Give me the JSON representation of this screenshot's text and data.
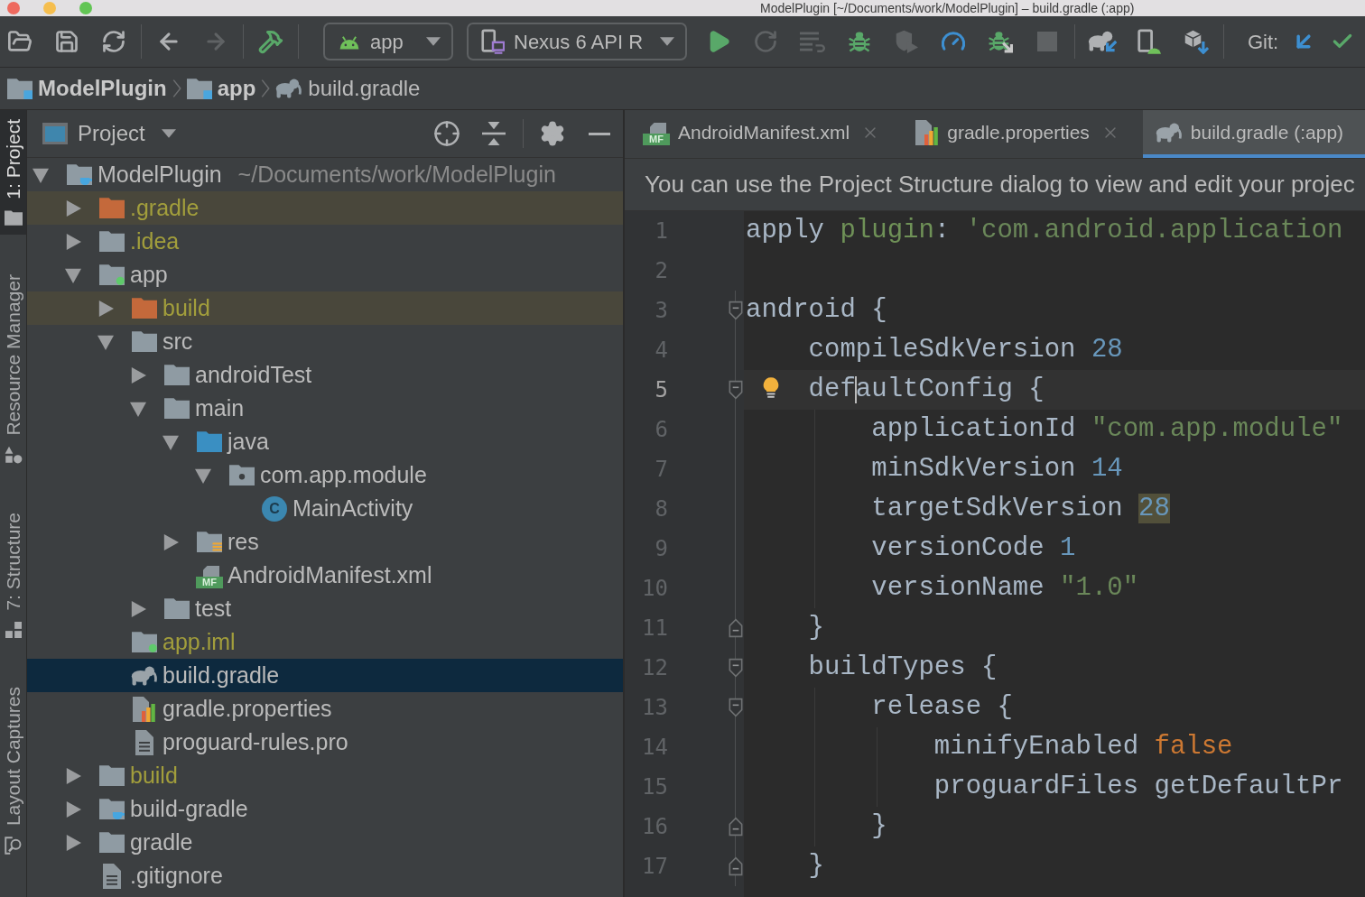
{
  "window": {
    "title": "ModelPlugin [~/Documents/work/ModelPlugin] – build.gradle (:app)"
  },
  "toolbar": [
    {
      "kind": "open",
      "disabled": false
    },
    {
      "kind": "save",
      "disabled": false
    },
    {
      "kind": "sync",
      "disabled": false
    },
    {
      "kind": "separator"
    },
    {
      "kind": "back",
      "disabled": false
    },
    {
      "kind": "forward",
      "disabled": true
    },
    {
      "kind": "separator"
    },
    {
      "kind": "build",
      "disabled": false
    },
    {
      "kind": "separator"
    },
    {
      "kind": "config",
      "label": "app"
    },
    {
      "kind": "device",
      "label": "Nexus 6 API R"
    },
    {
      "kind": "run",
      "disabled": false
    },
    {
      "kind": "apply",
      "disabled": true
    },
    {
      "kind": "hotswap",
      "disabled": true
    },
    {
      "kind": "debug",
      "disabled": false
    },
    {
      "kind": "coverage",
      "disabled": true
    },
    {
      "kind": "profile",
      "disabled": false
    },
    {
      "kind": "attach",
      "disabled": false
    },
    {
      "kind": "stop",
      "disabled": true
    },
    {
      "kind": "separator"
    },
    {
      "kind": "gradlesync",
      "disabled": false
    },
    {
      "kind": "avd",
      "disabled": false
    },
    {
      "kind": "sdk",
      "disabled": false
    },
    {
      "kind": "separator"
    },
    {
      "kind": "label",
      "label": "Git:"
    },
    {
      "kind": "update",
      "disabled": false
    },
    {
      "kind": "commit",
      "disabled": false
    }
  ],
  "breadcrumbs": [
    {
      "kind": "module",
      "label": "ModelPlugin"
    },
    {
      "kind": "module",
      "label": "app"
    },
    {
      "kind": "gradle",
      "label": "build.gradle"
    }
  ],
  "tool_tabs": [
    {
      "kind": "project",
      "label": "1: Project",
      "selected": true
    },
    {
      "kind": "resources",
      "label": "Resource Manager",
      "selected": false
    },
    {
      "kind": "structure",
      "label": "7: Structure",
      "selected": false
    },
    {
      "kind": "captures",
      "label": "Layout Captures",
      "selected": false
    }
  ],
  "project_panel": {
    "title": "Project",
    "tree": [
      {
        "name": "ModelPlugin",
        "path": "~/Documents/work/ModelPlugin",
        "kind": "project",
        "expanded": true,
        "ignored": false,
        "tinted": false,
        "selected": false,
        "children": [
          {
            "name": ".gradle",
            "kind": "excluded",
            "expanded": false,
            "ignored": true,
            "tinted": true,
            "selected": false
          },
          {
            "name": ".idea",
            "kind": "folder",
            "expanded": false,
            "ignored": true,
            "tinted": false,
            "selected": false
          },
          {
            "name": "app",
            "kind": "module",
            "expanded": true,
            "ignored": false,
            "tinted": false,
            "selected": false,
            "children": [
              {
                "name": "build",
                "kind": "excluded",
                "expanded": false,
                "ignored": true,
                "tinted": true,
                "selected": false
              },
              {
                "name": "src",
                "kind": "folder",
                "expanded": true,
                "ignored": false,
                "tinted": false,
                "selected": false,
                "children": [
                  {
                    "name": "androidTest",
                    "kind": "folder",
                    "expanded": false,
                    "ignored": false,
                    "tinted": false,
                    "selected": false
                  },
                  {
                    "name": "main",
                    "kind": "folder",
                    "expanded": true,
                    "ignored": false,
                    "tinted": false,
                    "selected": false,
                    "children": [
                      {
                        "name": "java",
                        "kind": "source",
                        "expanded": true,
                        "ignored": false,
                        "tinted": false,
                        "selected": false,
                        "children": [
                          {
                            "name": "com.app.module",
                            "kind": "package",
                            "expanded": true,
                            "ignored": false,
                            "tinted": false,
                            "selected": false,
                            "children": [
                              {
                                "name": "MainActivity",
                                "kind": "class",
                                "badge": "C",
                                "ignored": false,
                                "tinted": false,
                                "selected": false
                              }
                            ]
                          }
                        ]
                      },
                      {
                        "name": "res",
                        "kind": "resources",
                        "expanded": false,
                        "ignored": false,
                        "tinted": false,
                        "selected": false
                      },
                      {
                        "name": "AndroidManifest.xml",
                        "kind": "manifest",
                        "badge": "MF",
                        "ignored": false,
                        "tinted": false,
                        "selected": false
                      }
                    ]
                  },
                  {
                    "name": "test",
                    "kind": "folder",
                    "expanded": false,
                    "ignored": false,
                    "tinted": false,
                    "selected": false
                  }
                ]
              },
              {
                "name": "app.iml",
                "kind": "iml",
                "ignored": true,
                "tinted": false,
                "selected": false
              },
              {
                "name": "build.gradle",
                "kind": "gradle",
                "ignored": false,
                "tinted": false,
                "selected": true
              },
              {
                "name": "gradle.properties",
                "kind": "properties",
                "ignored": false,
                "tinted": false,
                "selected": false
              },
              {
                "name": "proguard-rules.pro",
                "kind": "text",
                "ignored": false,
                "tinted": false,
                "selected": false
              }
            ]
          },
          {
            "name": "build",
            "kind": "folder",
            "expanded": false,
            "ignored": true,
            "tinted": false,
            "selected": false
          },
          {
            "name": "build-gradle",
            "kind": "project",
            "expanded": false,
            "ignored": false,
            "tinted": false,
            "selected": false
          },
          {
            "name": "gradle",
            "kind": "folder",
            "expanded": false,
            "ignored": false,
            "tinted": false,
            "selected": false
          },
          {
            "name": ".gitignore",
            "kind": "text",
            "ignored": false,
            "tinted": false,
            "selected": false
          }
        ]
      }
    ]
  },
  "editor": {
    "tabs": [
      {
        "kind": "manifest",
        "badge": "MF",
        "label": "AndroidManifest.xml",
        "selected": false
      },
      {
        "kind": "properties",
        "label": "gradle.properties",
        "selected": false
      },
      {
        "kind": "gradle",
        "label": "build.gradle (:app)",
        "selected": true
      }
    ],
    "notification": "You can use the Project Structure dialog to view and edit your projec",
    "lines": [
      {
        "number": "1",
        "current": false,
        "tokens": [
          {
            "kind": "plain",
            "text": "apply ",
            "highlighted": false
          },
          {
            "kind": "named",
            "text": "plugin",
            "highlighted": false
          },
          {
            "kind": "plain",
            "text": ": ",
            "highlighted": false
          },
          {
            "kind": "string",
            "text": "'com.android.application",
            "highlighted": false
          }
        ]
      },
      {
        "number": "2",
        "current": false
      },
      {
        "number": "3",
        "current": false,
        "fold_start": true,
        "tokens": [
          {
            "kind": "plain",
            "text": "android {",
            "highlighted": false
          }
        ]
      },
      {
        "number": "4",
        "current": false,
        "tokens": [
          {
            "kind": "plain",
            "text": "    compileSdkVersion ",
            "highlighted": false
          },
          {
            "kind": "number",
            "text": "28",
            "highlighted": false
          }
        ]
      },
      {
        "number": "5",
        "current": true,
        "fold_start": true,
        "tokens": [
          {
            "kind": "plain",
            "text": "    def",
            "highlighted": false
          },
          {
            "kind": "caret"
          },
          {
            "kind": "plain",
            "text": "aultConfig {",
            "highlighted": false
          }
        ]
      },
      {
        "number": "6",
        "current": false,
        "tokens": [
          {
            "kind": "plain",
            "text": "        applicationId ",
            "highlighted": false
          },
          {
            "kind": "string",
            "text": "\"com.app.module\"",
            "highlighted": false
          }
        ]
      },
      {
        "number": "7",
        "current": false,
        "tokens": [
          {
            "kind": "plain",
            "text": "        minSdkVersion ",
            "highlighted": false
          },
          {
            "kind": "number",
            "text": "14",
            "highlighted": false
          }
        ]
      },
      {
        "number": "8",
        "current": false,
        "tokens": [
          {
            "kind": "plain",
            "text": "        targetSdkVersion ",
            "highlighted": false
          },
          {
            "kind": "number",
            "text": "28",
            "highlighted": true
          }
        ]
      },
      {
        "number": "9",
        "current": false,
        "tokens": [
          {
            "kind": "plain",
            "text": "        versionCode ",
            "highlighted": false
          },
          {
            "kind": "number",
            "text": "1",
            "highlighted": false
          }
        ]
      },
      {
        "number": "10",
        "current": false,
        "tokens": [
          {
            "kind": "plain",
            "text": "        versionName ",
            "highlighted": false
          },
          {
            "kind": "string",
            "text": "\"1.0\"",
            "highlighted": false
          }
        ]
      },
      {
        "number": "11",
        "current": false,
        "fold_end": true,
        "tokens": [
          {
            "kind": "plain",
            "text": "    }",
            "highlighted": false
          }
        ]
      },
      {
        "number": "12",
        "current": false,
        "fold_start": true,
        "tokens": [
          {
            "kind": "plain",
            "text": "    buildTypes {",
            "highlighted": false
          }
        ]
      },
      {
        "number": "13",
        "current": false,
        "fold_start": true,
        "tokens": [
          {
            "kind": "plain",
            "text": "        release {",
            "highlighted": false
          }
        ]
      },
      {
        "number": "14",
        "current": false,
        "tokens": [
          {
            "kind": "plain",
            "text": "            minifyEnabled ",
            "highlighted": false
          },
          {
            "kind": "keyword",
            "text": "false",
            "highlighted": false
          }
        ]
      },
      {
        "number": "15",
        "current": false,
        "tokens": [
          {
            "kind": "plain",
            "text": "            proguardFiles getDefaultPr",
            "highlighted": false
          }
        ]
      },
      {
        "number": "16",
        "current": false,
        "fold_end": true,
        "tokens": [
          {
            "kind": "plain",
            "text": "        }",
            "highlighted": false
          }
        ]
      },
      {
        "number": "17",
        "current": false,
        "fold_end": true,
        "tokens": [
          {
            "kind": "plain",
            "text": "    }",
            "highlighted": false
          }
        ]
      }
    ]
  }
}
